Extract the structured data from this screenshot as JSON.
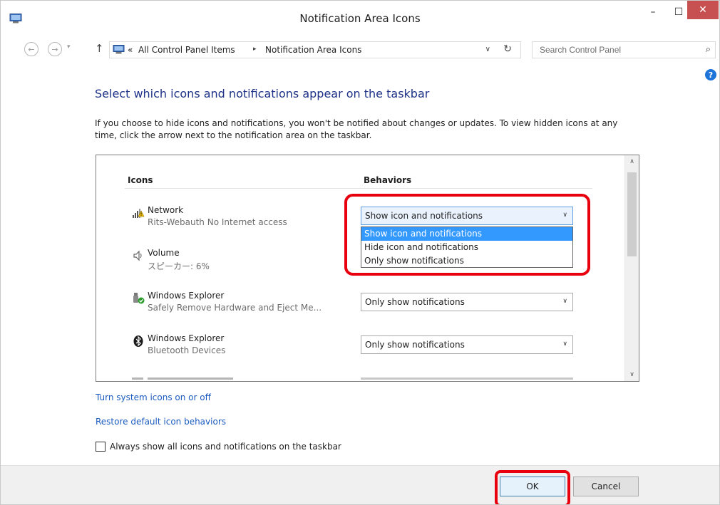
{
  "window": {
    "title": "Notification Area Icons",
    "minimize_glyph": "–",
    "maximize_glyph": "☐",
    "close_glyph": "✕"
  },
  "nav": {
    "back_glyph": "←",
    "forward_glyph": "→",
    "recent_glyph": "▾",
    "up_glyph": "↑",
    "breadcrumb_overflow": "«",
    "crumb_sep": "▸",
    "breadcrumb": [
      "All Control Panel Items",
      "Notification Area Icons"
    ],
    "address_dropdown_glyph": "∨",
    "refresh_glyph": "↻",
    "search_placeholder": "Search Control Panel",
    "search_glyph": "⌕",
    "help_glyph": "?"
  },
  "content": {
    "heading": "Select which icons and notifications appear on the taskbar",
    "description": "If you choose to hide icons and notifications, you won't be notified about changes or updates. To view hidden icons at any time, click the arrow next to the notification area on the taskbar."
  },
  "table": {
    "col_icons": "Icons",
    "col_behaviors": "Behaviors",
    "rows": [
      {
        "name": "Network",
        "sub": "Rits-Webauth No Internet access",
        "icon": "network-warning-icon",
        "behavior": "Show icon and notifications"
      },
      {
        "name": "Volume",
        "sub": "スピーカー: 6%",
        "icon": "speaker-icon",
        "behavior": ""
      },
      {
        "name": "Windows Explorer",
        "sub": "Safely Remove Hardware and Eject Me...",
        "icon": "usb-safe-remove-icon",
        "behavior": "Only show notifications"
      },
      {
        "name": "Windows Explorer",
        "sub": "Bluetooth Devices",
        "icon": "bluetooth-icon",
        "behavior": "Only show notifications"
      }
    ],
    "dropdown_options": [
      "Show icon and notifications",
      "Hide icon and notifications",
      "Only show notifications"
    ],
    "dropdown_selected_index": 0,
    "chevron_glyph": "∨",
    "scroll_up_glyph": "∧",
    "scroll_down_glyph": "∨"
  },
  "links": {
    "turn_system_icons": "Turn system icons on or off",
    "restore_defaults": "Restore default icon behaviors"
  },
  "checkbox": {
    "label": "Always show all icons and notifications on the taskbar",
    "checked": false
  },
  "buttons": {
    "ok": "OK",
    "cancel": "Cancel"
  },
  "colors": {
    "heading": "#1e3287",
    "link": "#1c5bbf",
    "selection": "#3399ff",
    "highlight_annotation": "#e8000f",
    "close_button": "#c75050"
  }
}
